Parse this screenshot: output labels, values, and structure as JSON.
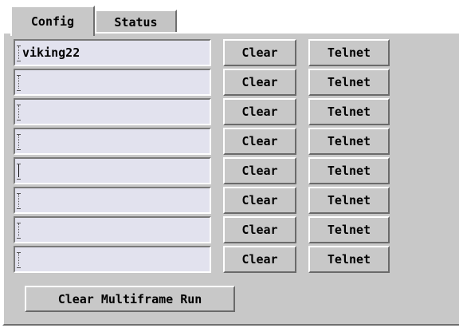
{
  "tabs": [
    {
      "label": "Config",
      "active": true
    },
    {
      "label": "Status",
      "active": false
    }
  ],
  "rows": [
    {
      "value": "viking22",
      "clear_label": "Clear",
      "telnet_label": "Telnet"
    },
    {
      "value": "",
      "clear_label": "Clear",
      "telnet_label": "Telnet"
    },
    {
      "value": "",
      "clear_label": "Clear",
      "telnet_label": "Telnet"
    },
    {
      "value": "",
      "clear_label": "Clear",
      "telnet_label": "Telnet"
    },
    {
      "value": "",
      "clear_label": "Clear",
      "telnet_label": "Telnet"
    },
    {
      "value": "",
      "clear_label": "Clear",
      "telnet_label": "Telnet"
    },
    {
      "value": "",
      "clear_label": "Clear",
      "telnet_label": "Telnet"
    },
    {
      "value": "",
      "clear_label": "Clear",
      "telnet_label": "Telnet"
    }
  ],
  "clear_multiframe_label": "Clear Multiframe Run",
  "colors": {
    "panel": "#c8c8c8",
    "field": "#e2e2ee"
  },
  "icons": [
    "text-caret-icon"
  ]
}
